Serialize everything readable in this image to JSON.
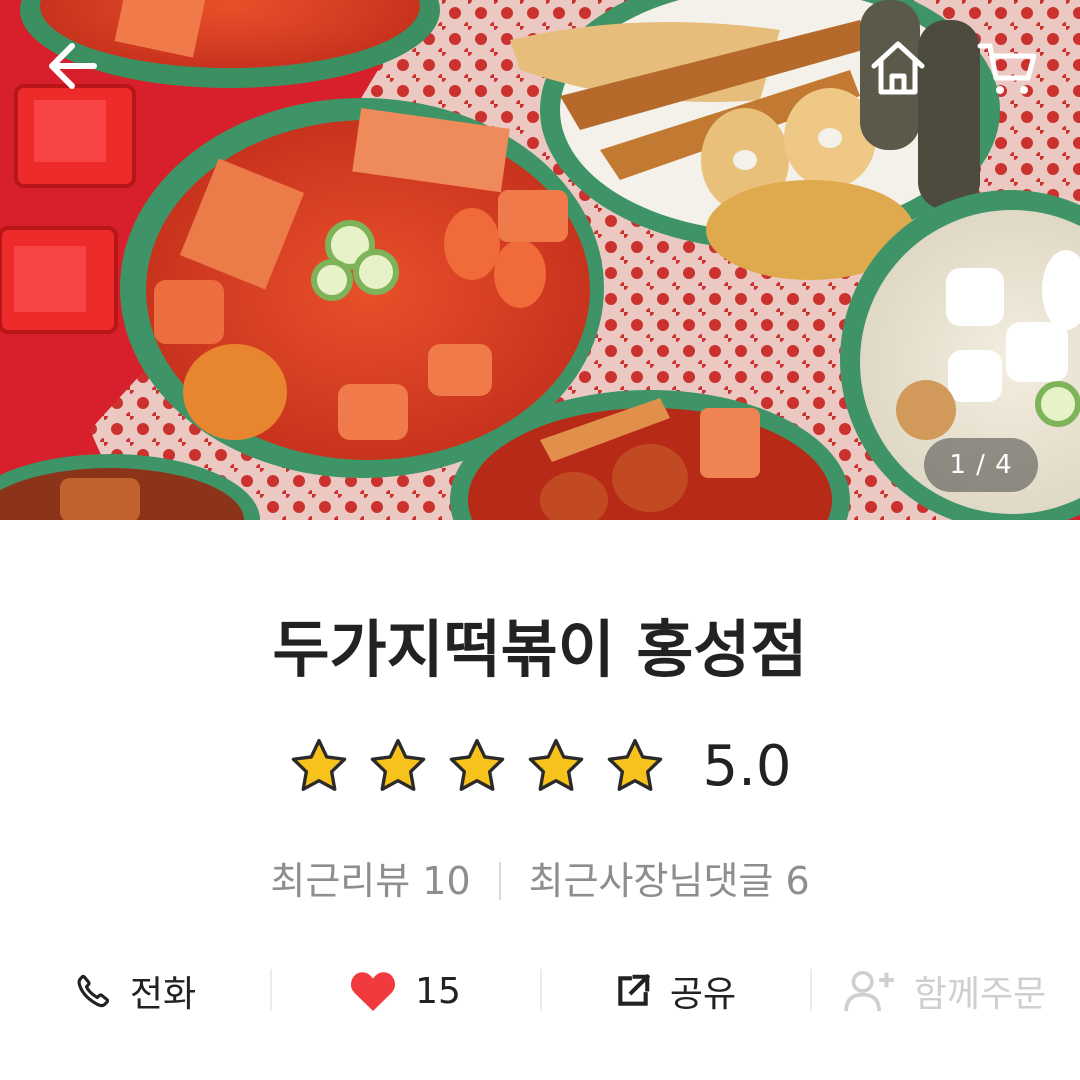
{
  "hero": {
    "image_counter": "1 / 4",
    "icons": {
      "back": "back-arrow-icon",
      "home": "home-icon",
      "cart": "cart-icon"
    }
  },
  "store": {
    "name": "두가지떡볶이 홍성점",
    "rating": "5.0",
    "stars_filled": 5,
    "star_color": "#f7c21b"
  },
  "stats": {
    "recent_reviews": "최근리뷰 10",
    "owner_replies": "최근사장님댓글 6"
  },
  "actions": {
    "call_label": "전화",
    "like_count": "15",
    "share_label": "공유",
    "group_order_label": "함께주문",
    "heart_color": "#f03a3d"
  }
}
